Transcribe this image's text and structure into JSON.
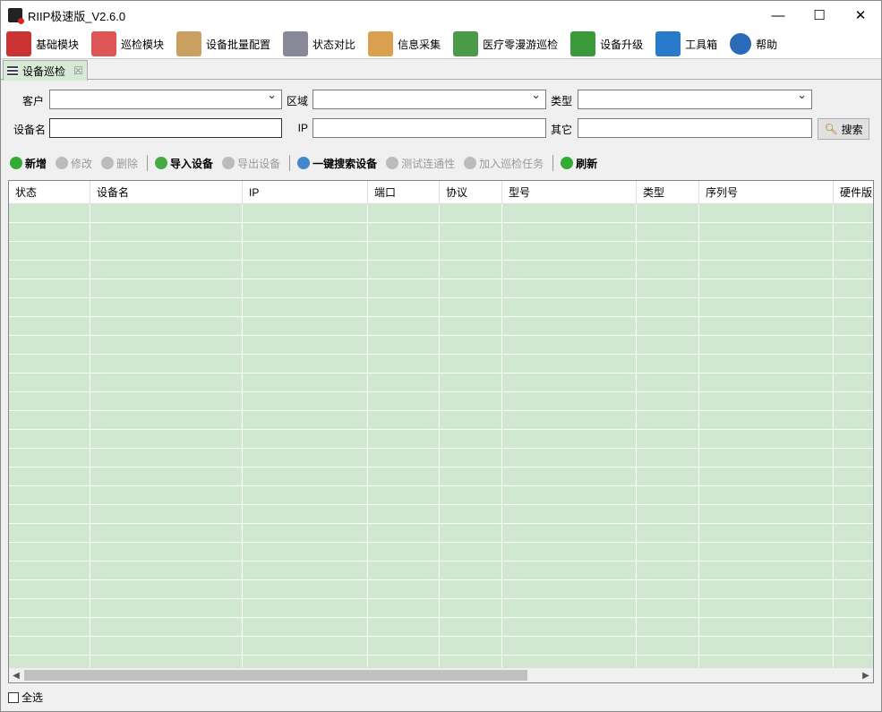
{
  "window": {
    "title": "RIIP极速版_V2.6.0",
    "minimize": "—",
    "maximize": "☐",
    "close": "✕"
  },
  "menu": [
    {
      "label": "基础模块",
      "icon": "binders-icon",
      "color": "#c33"
    },
    {
      "label": "巡检模块",
      "icon": "calendar-clock-icon",
      "color": "#d55"
    },
    {
      "label": "设备批量配置",
      "icon": "box-icon",
      "color": "#c9a060"
    },
    {
      "label": "状态对比",
      "icon": "table-compare-icon",
      "color": "#889"
    },
    {
      "label": "信息采集",
      "icon": "clipboard-icon",
      "color": "#d9a050"
    },
    {
      "label": "医疗零漫游巡检",
      "icon": "medical-cross-icon",
      "color": "#4a9a4a"
    },
    {
      "label": "设备升级",
      "icon": "upgrade-arrow-icon",
      "color": "#3a9a3a"
    },
    {
      "label": "工具箱",
      "icon": "toolbox-icon",
      "color": "#2a7acc"
    },
    {
      "label": "帮助",
      "icon": "help-icon",
      "color": "#2a6ab8"
    }
  ],
  "tab": {
    "label": "设备巡检",
    "close": "☒"
  },
  "filters": {
    "customer": "客户",
    "region": "区域",
    "type": "类型",
    "device_name": "设备名",
    "ip": "IP",
    "other": "其它",
    "search": "搜索"
  },
  "toolbar": [
    {
      "label": "新增",
      "enabled": true,
      "color": "#3a3"
    },
    {
      "label": "修改",
      "enabled": false,
      "color": "#bbb"
    },
    {
      "label": "删除",
      "enabled": false,
      "color": "#bbb"
    },
    {
      "label": "导入设备",
      "enabled": true,
      "color": "#4a4"
    },
    {
      "label": "导出设备",
      "enabled": false,
      "color": "#bbb"
    },
    {
      "label": "一键搜索设备",
      "enabled": true,
      "color": "#48c"
    },
    {
      "label": "测试连通性",
      "enabled": false,
      "color": "#bbb"
    },
    {
      "label": "加入巡检任务",
      "enabled": false,
      "color": "#bbb"
    },
    {
      "label": "刷新",
      "enabled": true,
      "color": "#3a3"
    }
  ],
  "columns": [
    "状态",
    "设备名",
    "IP",
    "端口",
    "协议",
    "型号",
    "类型",
    "序列号",
    "硬件版本"
  ],
  "select_all": "全选"
}
